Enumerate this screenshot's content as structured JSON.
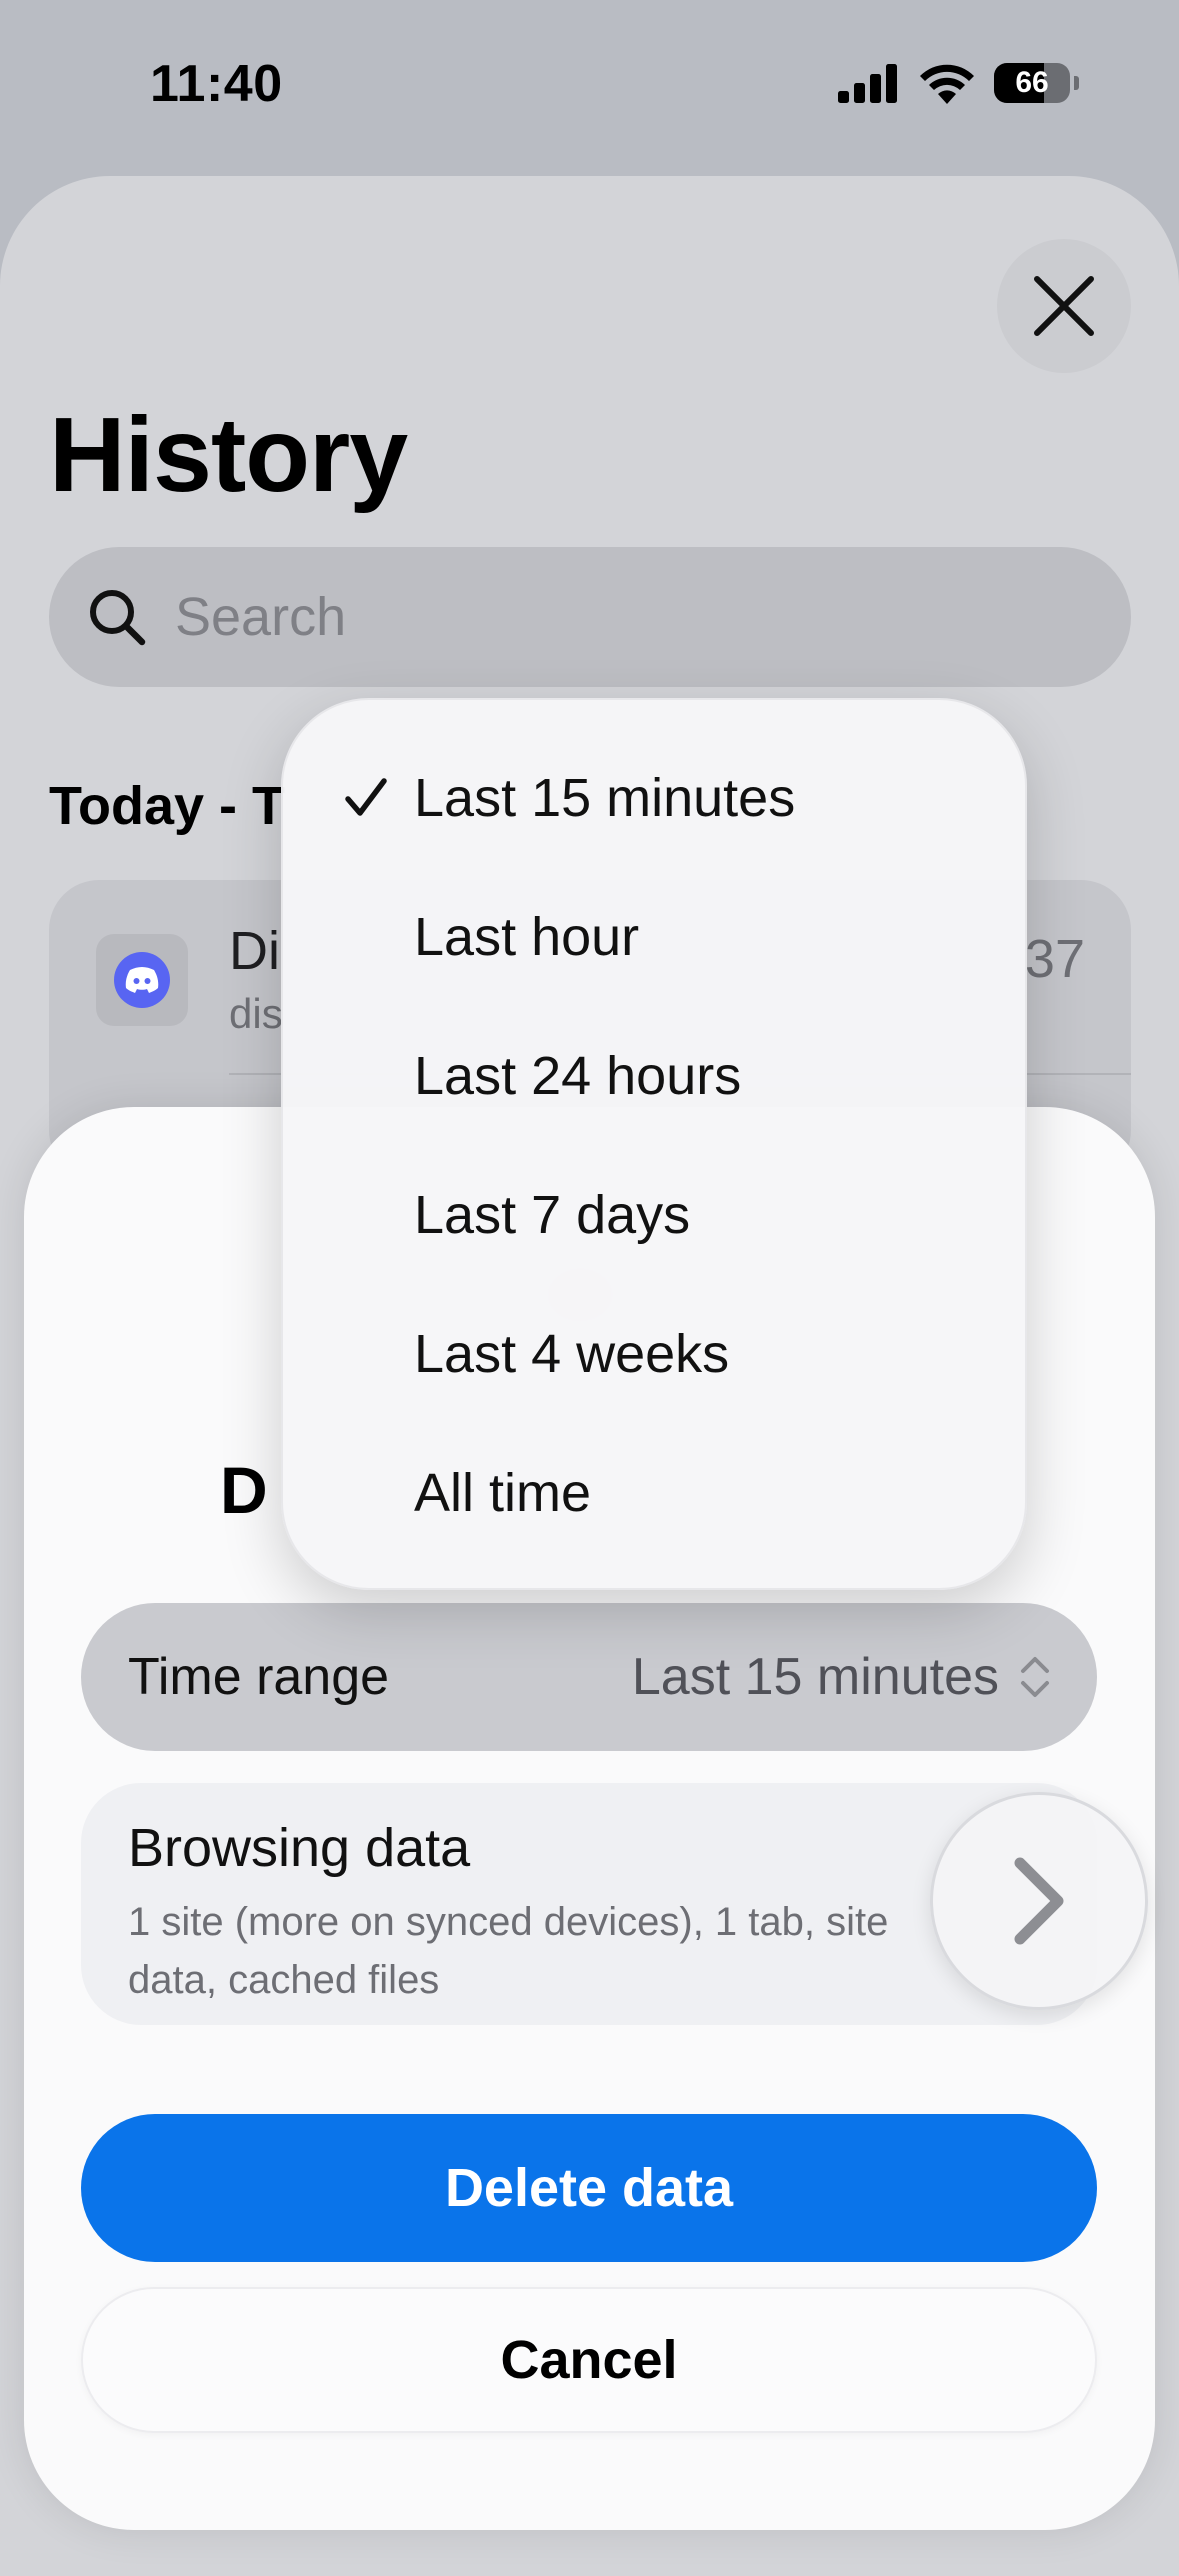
{
  "status_bar": {
    "time": "11:40",
    "battery": "66",
    "battery_level": 0.66
  },
  "history": {
    "title": "History",
    "search_placeholder": "Search",
    "section_header": "Today - T",
    "entry": {
      "title": "Di",
      "url": "dis",
      "time": "37"
    }
  },
  "delete_sheet": {
    "title": "D",
    "time_range_label": "Time range",
    "time_range_value": "Last 15 minutes",
    "browsing_data_title": "Browsing data",
    "browsing_data_desc": "1 site (more on synced devices), 1 tab, site data, cached files",
    "delete_label": "Delete data",
    "cancel_label": "Cancel"
  },
  "dropdown": {
    "selected_index": 0,
    "options": [
      "Last 15 minutes",
      "Last hour",
      "Last 24 hours",
      "Last 7 days",
      "Last 4 weeks",
      "All time"
    ]
  },
  "colors": {
    "accent": "#0a74ea",
    "favicon": "#5865f2"
  },
  "icons": {
    "signal": "signal-icon",
    "wifi": "wifi-icon",
    "battery": "battery-icon",
    "close": "close-icon",
    "search": "search-icon",
    "check": "checkmark-icon",
    "chevron_updown": "chevron-updown-icon",
    "chevron_right": "chevron-right-icon"
  }
}
